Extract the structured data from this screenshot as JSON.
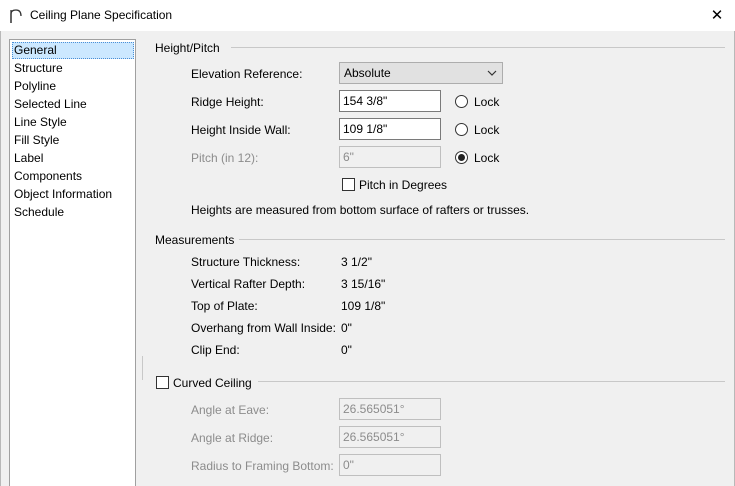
{
  "window": {
    "title": "Ceiling Plane Specification",
    "close_glyph": "✕"
  },
  "nav": {
    "items": [
      {
        "label": "General",
        "selected": true
      },
      {
        "label": "Structure"
      },
      {
        "label": "Polyline"
      },
      {
        "label": "Selected Line"
      },
      {
        "label": "Line Style"
      },
      {
        "label": "Fill Style"
      },
      {
        "label": "Label"
      },
      {
        "label": "Components"
      },
      {
        "label": "Object Information"
      },
      {
        "label": "Schedule"
      }
    ]
  },
  "height_pitch": {
    "section_title": "Height/Pitch",
    "elevation_reference_label": "Elevation Reference:",
    "elevation_reference_value": "Absolute",
    "ridge_height_label": "Ridge Height:",
    "ridge_height_value": "154 3/8\"",
    "ridge_lock_label": "Lock",
    "ridge_lock_checked": false,
    "height_inside_wall_label": "Height Inside Wall:",
    "height_inside_wall_value": "109 1/8\"",
    "wall_lock_label": "Lock",
    "wall_lock_checked": false,
    "pitch_label": "Pitch (in 12):",
    "pitch_value": "6\"",
    "pitch_lock_label": "Lock",
    "pitch_lock_checked": true,
    "pitch_in_degrees_label": "Pitch in Degrees",
    "pitch_in_degrees_checked": false,
    "note": "Heights are measured from bottom surface of rafters or trusses."
  },
  "measurements": {
    "section_title": "Measurements",
    "rows": [
      {
        "label": "Structure Thickness:",
        "value": "3 1/2\""
      },
      {
        "label": "Vertical Rafter Depth:",
        "value": "3 15/16\""
      },
      {
        "label": "Top of Plate:",
        "value": "109 1/8\""
      },
      {
        "label": "Overhang from Wall Inside:",
        "value": "0\""
      },
      {
        "label": "Clip End:",
        "value": "0\""
      }
    ]
  },
  "curved_ceiling": {
    "label": "Curved Ceiling",
    "checked": false,
    "angle_at_eave_label": "Angle at Eave:",
    "angle_at_eave_value": "26.565051°",
    "angle_at_ridge_label": "Angle at Ridge:",
    "angle_at_ridge_value": "26.565051°",
    "radius_label": "Radius to Framing Bottom:",
    "radius_value": "0\""
  },
  "icons": {
    "app": "ceiling-arc-icon",
    "close": "close-icon",
    "dropdown": "chevron-down-icon"
  }
}
